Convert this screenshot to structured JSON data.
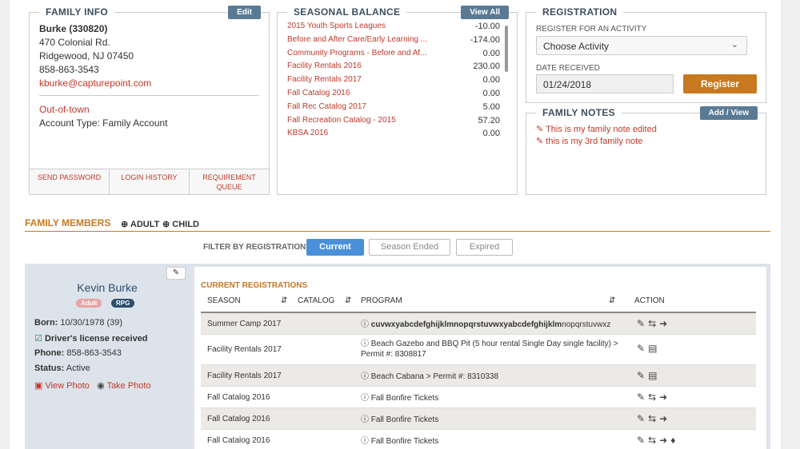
{
  "family_info": {
    "title": "FAMILY INFO",
    "edit_label": "Edit",
    "name": "Burke (330820)",
    "address1": "470 Colonial Rd.",
    "address2": "Ridgewood, NJ 07450",
    "phone": "858-863-3543",
    "email": "kburke@capturepoint.com",
    "residency": "Out-of-town",
    "account_type": "Account Type: Family Account",
    "footer": {
      "send_password": "SEND PASSWORD",
      "login_history": "LOGIN HISTORY",
      "requirement_queue": "REQUIREMENT QUEUE"
    }
  },
  "seasonal_balance": {
    "title": "SEASONAL BALANCE",
    "view_all_label": "View All",
    "rows": [
      {
        "name": "2015 Youth Sports Leagues",
        "amount": "-10.00"
      },
      {
        "name": "Before and After Care/Early Learning ...",
        "amount": "-174.00"
      },
      {
        "name": "Community Programs - Before and Af...",
        "amount": "0.00"
      },
      {
        "name": "Facility Rentals 2016",
        "amount": "230.00"
      },
      {
        "name": "Facility Rentals 2017",
        "amount": "0.00"
      },
      {
        "name": "Fall Catalog 2016",
        "amount": "0.00"
      },
      {
        "name": "Fall Rec Catalog 2017",
        "amount": "5.00"
      },
      {
        "name": "Fall Recreation Catalog - 2015",
        "amount": "57.20"
      },
      {
        "name": "KBSA 2016",
        "amount": "0.00"
      }
    ]
  },
  "registration": {
    "title": "REGISTRATION",
    "activity_label": "REGISTER FOR AN ACTIVITY",
    "activity_value": "Choose Activity",
    "date_label": "DATE RECEIVED",
    "date_value": "01/24/2018",
    "register_label": "Register"
  },
  "family_notes": {
    "title": "FAMILY NOTES",
    "add_view_label": "Add / View",
    "notes": [
      "This is my family note edited",
      "this is my 3rd family note"
    ]
  },
  "family_members": {
    "title": "FAMILY MEMBERS",
    "add_adult": "ADULT",
    "add_child": "CHILD"
  },
  "filter": {
    "label": "FILTER BY REGISTRATION:",
    "options": [
      "Current",
      "Season Ended",
      "Expired"
    ],
    "selected": "Current"
  },
  "member": {
    "name": "Kevin Burke",
    "badges": [
      "Adult",
      "RPG"
    ],
    "born_label": "Born:",
    "born_value": "10/30/1978 (39)",
    "license": "Driver's license received",
    "phone_label": "Phone:",
    "phone_value": "858-863-3543",
    "status_label": "Status:",
    "status_value": "Active",
    "view_photo": "View Photo",
    "take_photo": "Take Photo"
  },
  "registrations": {
    "title": "CURRENT REGISTRATIONS",
    "headers": [
      "SEASON",
      "CATALOG",
      "PROGRAM",
      "ACTION"
    ],
    "rows": [
      {
        "season": "Summer Camp 2017",
        "program_bold": "cuvwxyabcdefghijklmnopqrstuvwxyabcdefghijklm",
        "program_rest": "nopqrstuvwxz",
        "line2": ""
      },
      {
        "season": "Facility Rentals 2017",
        "program_bold": "",
        "program_rest": "Beach Gazebo and BBQ Pit (5 hour rental Single Day single facility) >",
        "line2": "Permit #: 8308817"
      },
      {
        "season": "Facility Rentals 2017",
        "program_bold": "",
        "program_rest": "Beach Cabana > Permit #: 8310338",
        "line2": ""
      },
      {
        "season": "Fall Catalog 2016",
        "program_bold": "",
        "program_rest": "Fall Bonfire Tickets",
        "line2": ""
      },
      {
        "season": "Fall Catalog 2016",
        "program_bold": "",
        "program_rest": "Fall Bonfire Tickets",
        "line2": ""
      },
      {
        "season": "Fall Catalog 2016",
        "program_bold": "",
        "program_rest": "Fall Bonfire Tickets",
        "line2": ""
      }
    ]
  }
}
